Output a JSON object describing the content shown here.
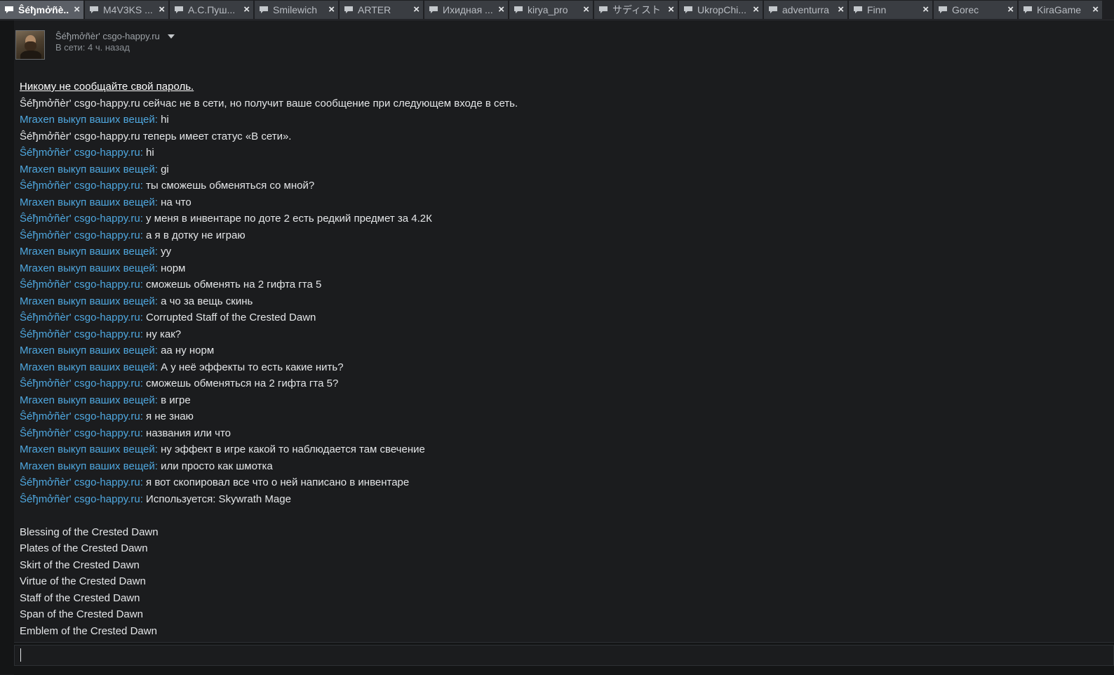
{
  "tabs": [
    {
      "label": "Ŝéђmởñè..",
      "active": true
    },
    {
      "label": "M4V3KS ..."
    },
    {
      "label": "А.С.Пуш..."
    },
    {
      "label": "Smilewich"
    },
    {
      "label": "ARTER"
    },
    {
      "label": "Ихидная ..."
    },
    {
      "label": "kirya_pro"
    },
    {
      "label": "サディスト"
    },
    {
      "label": "UkropChi..."
    },
    {
      "label": "adventurra"
    },
    {
      "label": "Finn"
    },
    {
      "label": "Gorec"
    },
    {
      "label": "KiraGame"
    }
  ],
  "tab_close_glyph": "×",
  "header": {
    "name": "Ŝéђmởñèr' csgo-happy.ru",
    "status": "В сети: 4 ч. назад"
  },
  "messages": [
    {
      "type": "warn",
      "text": "Никому не сообщайте свой пароль."
    },
    {
      "type": "system",
      "text": "Ŝéђmởñèr' csgo-happy.ru сейчас не в сети, но получит ваше сообщение при следующем входе в сеть."
    },
    {
      "type": "msg",
      "speaker": "Mraxen выкуп ваших вещей",
      "text": "hi"
    },
    {
      "type": "system",
      "text": "Ŝéђmởñèr' csgo-happy.ru теперь имеет статус «В сети»."
    },
    {
      "type": "msg",
      "speaker": "Ŝéђmởñèr' csgo-happy.ru",
      "text": "hi"
    },
    {
      "type": "msg",
      "speaker": "Mraxen выкуп ваших вещей",
      "text": "gi"
    },
    {
      "type": "msg",
      "speaker": "Ŝéђmởñèr' csgo-happy.ru",
      "text": "ты сможешь обменяться со мной?"
    },
    {
      "type": "msg",
      "speaker": "Mraxen выкуп ваших вещей",
      "text": "на что"
    },
    {
      "type": "msg",
      "speaker": "Ŝéђmởñèr' csgo-happy.ru",
      "text": "у меня в инвентаре по доте 2 есть редкий предмет за 4.2К"
    },
    {
      "type": "msg",
      "speaker": "Ŝéђmởñèr' csgo-happy.ru",
      "text": "а я в дотку не играю"
    },
    {
      "type": "msg",
      "speaker": "Mraxen выкуп ваших вещей",
      "text": "уу"
    },
    {
      "type": "msg",
      "speaker": "Mraxen выкуп ваших вещей",
      "text": "норм"
    },
    {
      "type": "msg",
      "speaker": "Ŝéђmởñèr' csgo-happy.ru",
      "text": "сможешь обменять на 2 гифта гта 5"
    },
    {
      "type": "msg",
      "speaker": "Mraxen выкуп ваших вещей",
      "text": "а чо за вещь скинь"
    },
    {
      "type": "msg",
      "speaker": "Ŝéђmởñèr' csgo-happy.ru",
      "text": "Corrupted Staff of the Crested Dawn"
    },
    {
      "type": "msg",
      "speaker": "Ŝéђmởñèr' csgo-happy.ru",
      "text": "ну как?"
    },
    {
      "type": "msg",
      "speaker": "Mraxen выкуп ваших вещей",
      "text": "аа ну норм"
    },
    {
      "type": "msg",
      "speaker": "Mraxen выкуп ваших вещей",
      "text": "А у неё эффекты то есть какие нить?"
    },
    {
      "type": "msg",
      "speaker": "Ŝéђmởñèr' csgo-happy.ru",
      "text": "сможешь обменяться на 2 гифта гта 5?"
    },
    {
      "type": "msg",
      "speaker": "Mraxen выкуп ваших вещей",
      "text": "в игре"
    },
    {
      "type": "msg",
      "speaker": "Ŝéђmởñèr' csgo-happy.ru",
      "text": "я не знаю"
    },
    {
      "type": "msg",
      "speaker": "Ŝéђmởñèr' csgo-happy.ru",
      "text": "названия или что"
    },
    {
      "type": "msg",
      "speaker": "Mraxen выкуп ваших вещей",
      "text": "ну эффект в игре какой то наблюдается там свечение"
    },
    {
      "type": "msg",
      "speaker": "Mraxen выкуп ваших вещей",
      "text": "или просто как шмотка"
    },
    {
      "type": "msg",
      "speaker": "Ŝéђmởñèr' csgo-happy.ru",
      "text": "я вот скопировал все что о ней написано в инвентаре"
    },
    {
      "type": "msg",
      "speaker": "Ŝéђmởñèr' csgo-happy.ru",
      "text": "Используется: Skywrath Mage"
    },
    {
      "type": "blank"
    },
    {
      "type": "plain",
      "text": "Blessing of the Crested Dawn"
    },
    {
      "type": "plain",
      "text": "Plates of the Crested Dawn"
    },
    {
      "type": "plain",
      "text": "Skirt of the Crested Dawn"
    },
    {
      "type": "plain",
      "text": "Virtue of the Crested Dawn"
    },
    {
      "type": "plain",
      "text": "Staff of the Crested Dawn"
    },
    {
      "type": "plain",
      "text": "Span of the Crested Dawn"
    },
    {
      "type": "plain",
      "text": "Emblem of the Crested Dawn"
    }
  ],
  "input": {
    "value": "",
    "placeholder": ""
  },
  "colors": {
    "speaker": "#4fa8e0",
    "text": "#e4e6e8",
    "background": "#1b1c1e"
  }
}
